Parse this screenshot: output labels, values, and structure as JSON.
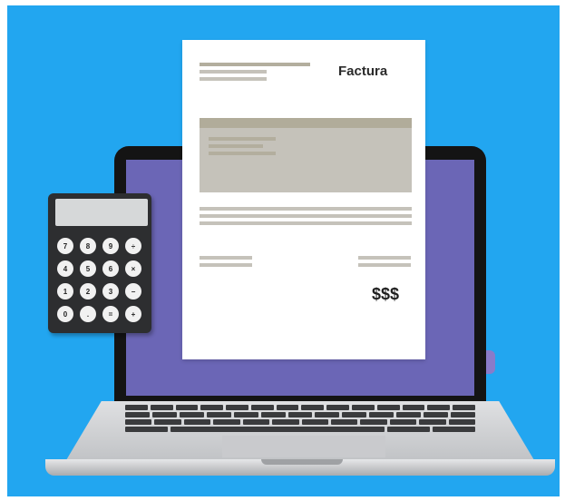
{
  "invoice": {
    "title": "Factura",
    "amount": "$$$"
  },
  "calculator": {
    "keys": [
      "7",
      "8",
      "9",
      "÷",
      "4",
      "5",
      "6",
      "×",
      "1",
      "2",
      "3",
      "−",
      "0",
      ".",
      "=",
      "+"
    ]
  },
  "colors": {
    "background": "#22a6f0",
    "screen": "#6b66b6",
    "paper": "#ffffff",
    "lines": "#c5c2ba"
  }
}
